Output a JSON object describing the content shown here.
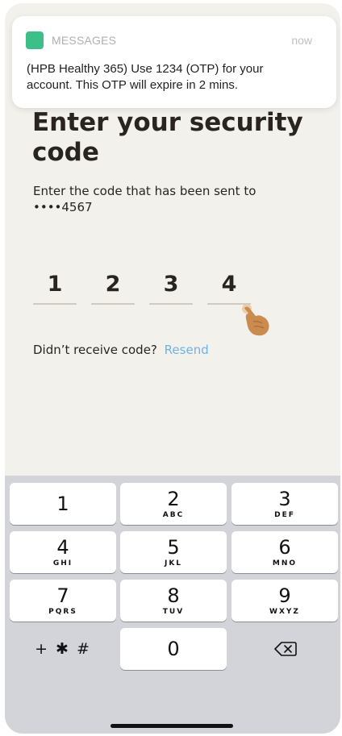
{
  "notification": {
    "app_name": "MESSAGES",
    "time": "now",
    "body": "(HPB Healthy 365) Use 1234 (OTP) for your account.  This OTP will expire in 2 mins.",
    "icon": "messages-app-icon",
    "icon_color": "#3dbf8a"
  },
  "screen": {
    "title": "Enter your security code",
    "instruction": "Enter the code that has been sent to ••••4567",
    "otp_digits": [
      "1",
      "2",
      "3",
      "4"
    ],
    "resend_prompt": "Didn’t receive code?",
    "resend_link": "Resend",
    "link_color": "#6fb2e5"
  },
  "keypad": {
    "keys": [
      {
        "digit": "1",
        "letters": ""
      },
      {
        "digit": "2",
        "letters": "ABC"
      },
      {
        "digit": "3",
        "letters": "DEF"
      },
      {
        "digit": "4",
        "letters": "GHI"
      },
      {
        "digit": "5",
        "letters": "JKL"
      },
      {
        "digit": "6",
        "letters": "MNO"
      },
      {
        "digit": "7",
        "letters": "PQRS"
      },
      {
        "digit": "8",
        "letters": "TUV"
      },
      {
        "digit": "9",
        "letters": "WXYZ"
      }
    ],
    "symbols_label": "+ ✱ #",
    "zero": "0",
    "delete_icon": "backspace-icon"
  }
}
